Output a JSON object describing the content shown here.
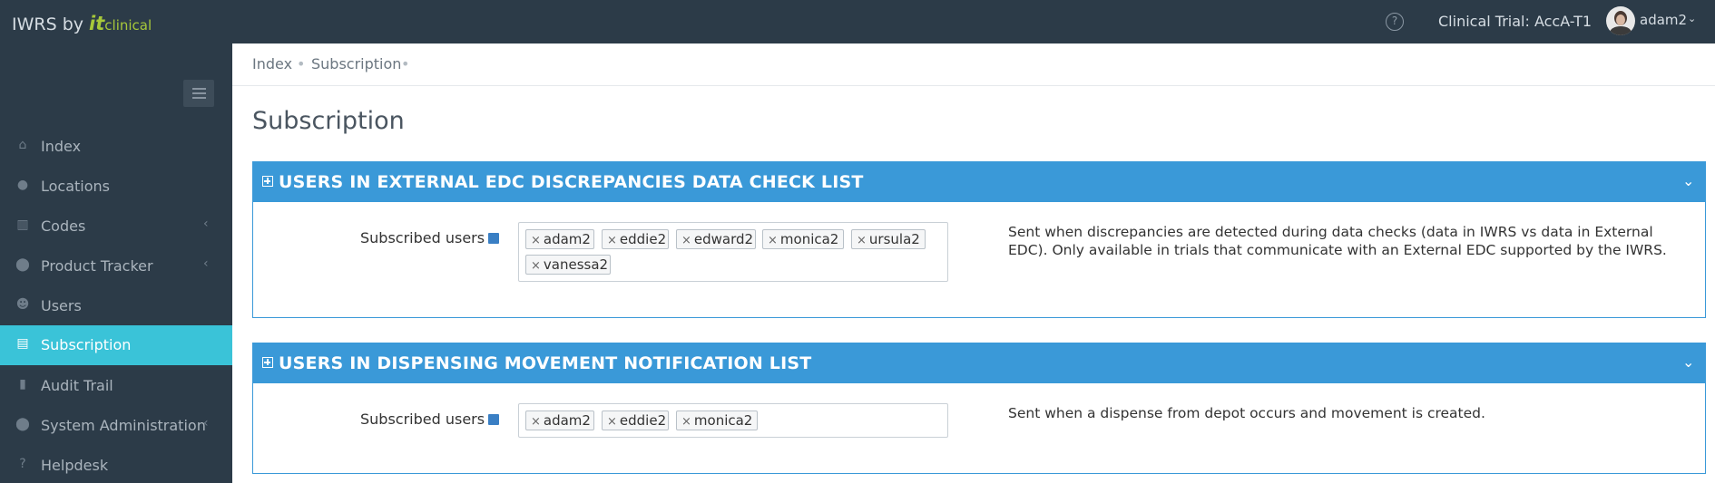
{
  "header": {
    "brand": "IWRS by",
    "brand_logo_it": "it",
    "brand_logo_clinical": "clinical",
    "help_icon": "?",
    "trial_label": "Clinical Trial: AccA-T1",
    "username": "adam2",
    "user_caret": "⌄"
  },
  "sidebar": {
    "items": [
      {
        "label": "Index",
        "icon": "⌂",
        "icon_name": "home-icon"
      },
      {
        "label": "Locations",
        "icon": "●",
        "icon_name": "globe-icon"
      },
      {
        "label": "Codes",
        "icon": "▥",
        "icon_name": "barcode-icon"
      },
      {
        "label": "Product Tracker",
        "icon": "⬤",
        "icon_name": "map-marker-icon"
      },
      {
        "label": "Users",
        "icon": "☻",
        "icon_name": "users-icon"
      },
      {
        "label": "Subscription",
        "icon": "▤",
        "icon_name": "archive-icon"
      },
      {
        "label": "Audit Trail",
        "icon": "▮",
        "icon_name": "book-icon"
      },
      {
        "label": "System Administration",
        "icon": "⬤",
        "icon_name": "map-marker-icon"
      },
      {
        "label": "Helpdesk",
        "icon": "?",
        "icon_name": "question-icon"
      }
    ],
    "chevron": "‹",
    "active_color": "#3ac3d8"
  },
  "breadcrumb": {
    "items": [
      "Index",
      "Subscription"
    ],
    "separator": "•"
  },
  "page": {
    "title": "Subscription"
  },
  "panels": [
    {
      "title": "USERS IN EXTERNAL EDC DISCREPANCIES DATA CHECK LIST",
      "subscribed_label": "Subscribed users",
      "tags": [
        "adam2",
        "eddie2",
        "edward2",
        "monica2",
        "ursula2",
        "vanessa2"
      ],
      "description": "Sent when discrepancies are detected during data checks (data in IWRS vs data in External EDC). Only available in trials that communicate with an External EDC supported by the IWRS."
    },
    {
      "title": "USERS IN DISPENSING MOVEMENT NOTIFICATION LIST",
      "subscribed_label": "Subscribed users",
      "tags": [
        "adam2",
        "eddie2",
        "monica2"
      ],
      "description": "Sent when a dispense from depot occurs and movement is created."
    }
  ],
  "ui": {
    "tag_remove": "×",
    "collapse_icon": "⌄",
    "accent_color": "#3a99d8"
  }
}
